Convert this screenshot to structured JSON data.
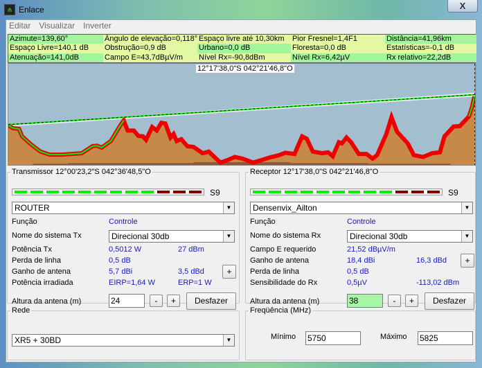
{
  "window": {
    "title": "Enlace",
    "close": "X",
    "icon": "link-antenna-icon"
  },
  "menu": [
    "Editar",
    "Visualizar",
    "Inverter"
  ],
  "stats": [
    [
      "Azimute=139,60°",
      "Ângulo de elevação=0,118°",
      "Espaço livre até 10,30km",
      "Pior Fresnel=1,4F1",
      "Distância=41,96km"
    ],
    [
      "Espaço Livre=140,1 dB",
      "Obstrução=0,9 dB",
      "Urbano=0,0 dB",
      "Floresta=0,0 dB",
      "Estatísticas=-0,1 dB"
    ],
    [
      "Atenuação=141,0dB",
      "Campo E=43,7dBµV/m",
      "Nível Rx=-90,8dBm",
      "Nível Rx=6,42µV",
      "Rx relativo=22,2dB"
    ]
  ],
  "profile": {
    "cursor_coord": "12°17'38,0\"S 042°21'46,8\"O",
    "colors": {
      "sky": "#a3bfcf",
      "terrain": "#c68a48",
      "clear": "#00ee00",
      "obstructed": "#ee0000"
    }
  },
  "tx": {
    "title": "Transmissor 12°00'23,2\"S 042°36'48,5\"O",
    "signal_label": "S9",
    "signal_level_segments": 9,
    "signal_total_segments": 12,
    "station": "ROUTER",
    "rows": [
      [
        "Função",
        "Controle",
        ""
      ],
      [
        "Nome do sistema Tx",
        "",
        ""
      ],
      [
        "Potência Tx",
        "0,5012 W",
        "27 dBm"
      ],
      [
        "Perda de linha",
        "0,5 dB",
        ""
      ],
      [
        "Ganho de antena",
        "5,7 dBi",
        "3,5 dBd"
      ],
      [
        "Potência irradiada",
        "EIRP=1,64 W",
        "ERP=1 W"
      ]
    ],
    "system": "Direcional 30db",
    "height_label": "Altura da antena (m)",
    "height": "24",
    "minus": "-",
    "plus": "+",
    "undo": "Desfazer"
  },
  "rx": {
    "title": "Receptor 12°17'38,0\"S 042°21'46,8\"O",
    "signal_label": "S9",
    "signal_level_segments": 9,
    "signal_total_segments": 12,
    "station": "Densenvix_Ailton",
    "rows": [
      [
        "Função",
        "Controle",
        ""
      ],
      [
        "Nome do sistema Rx",
        "",
        ""
      ],
      [
        "Campo E requerido",
        "21,52 dBµV/m",
        ""
      ],
      [
        "Ganho de antena",
        "18,4 dBi",
        "16,3 dBd"
      ],
      [
        "Perda de linha",
        "0,5 dB",
        ""
      ],
      [
        "Sensibilidade do Rx",
        "0,5µV",
        "-113,02 dBm"
      ]
    ],
    "system": "Direcional 30db",
    "height_label": "Altura da antena (m)",
    "height": "38",
    "minus": "-",
    "plus": "+",
    "undo": "Desfazer"
  },
  "network": {
    "title": "Rede",
    "value": "XR5 + 30BD"
  },
  "frequency": {
    "title": "Freqüência (MHz)",
    "min_label": "Mínimo",
    "min": "5750",
    "max_label": "Máximo",
    "max": "5825"
  }
}
